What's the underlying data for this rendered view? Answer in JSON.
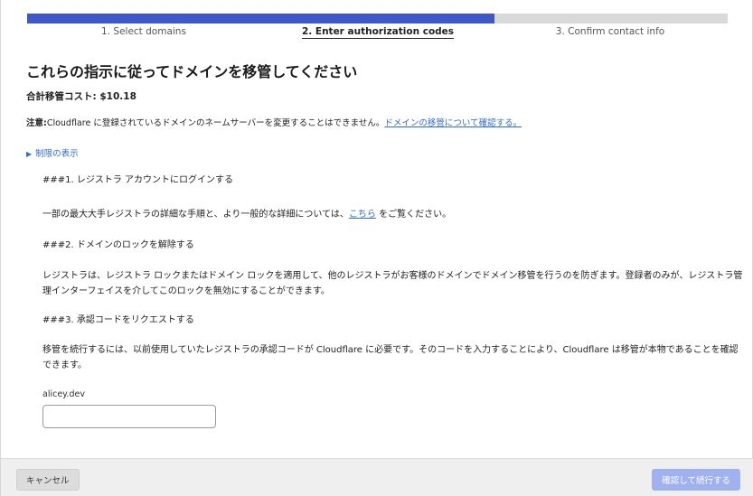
{
  "progress": {
    "fraction": 0.667,
    "fill_color": "#3f57c7",
    "track_color": "#d9d9d9"
  },
  "steps": [
    {
      "label": "1. Select domains"
    },
    {
      "label": "2. Enter authorization codes"
    },
    {
      "label": "3. Confirm contact info"
    }
  ],
  "heading": "これらの指示に従ってドメインを移管してください",
  "cost": "合計移管コスト: $10.18",
  "note": {
    "prefix": "注意:",
    "text": "Cloudflare に登録されているドメインのネームサーバーを変更することはできません。",
    "link": "ドメインの移管について確認する。"
  },
  "toggle": {
    "label": "制限の表示"
  },
  "instructions": {
    "h1": "###1.  レジストラ アカウントにログインする",
    "p1_before": "一部の最大大手レジストラの詳細な手順と、より一般的な詳細については、",
    "p1_link": "こちら",
    "p1_after": " をご覧ください。",
    "h2": "###2.  ドメインのロックを解除する",
    "p2": "レジストラは、レジストラ ロックまたはドメイン ロックを適用して、他のレジストラがお客様のドメインでドメイン移管を行うのを防ぎます。登録者のみが、レジストラ管理インターフェイスを介してこのロックを無効にすることができます。",
    "h3": "###3.  承認コードをリクエストする",
    "p3": "移管を続行するには、以前使用していたレジストラの承認コードが Cloudflare に必要です。そのコードを入力することにより、Cloudflare は移管が本物であることを確認できます。"
  },
  "domain_field": {
    "label": "alicey.dev",
    "value": "",
    "placeholder": ""
  },
  "footer": {
    "cancel_label": "キャンセル",
    "continue_label": "確認して続行する"
  }
}
